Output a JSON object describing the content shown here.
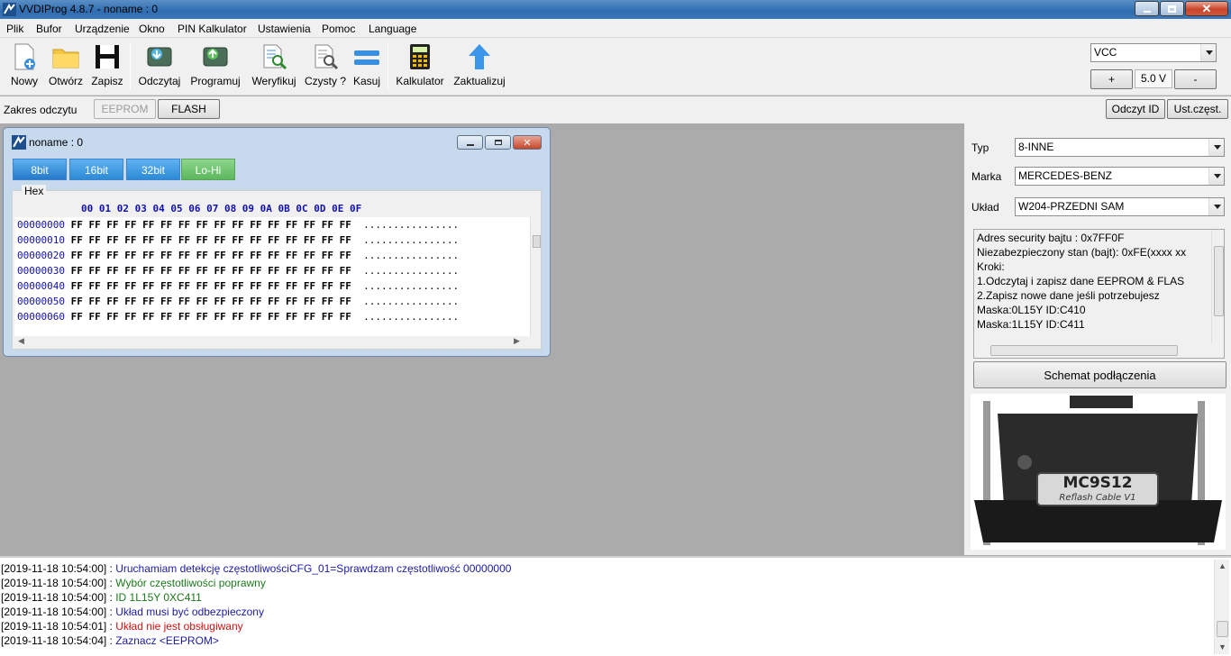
{
  "window": {
    "title": "VVDIProg 4.8.7 - noname : 0"
  },
  "menu": [
    "Plik",
    "Bufor",
    "Urządzenie",
    "Okno",
    "PIN Kalkulator",
    "Ustawienia",
    "Pomoc",
    "Language"
  ],
  "toolbar": {
    "new": "Nowy",
    "open": "Otwórz",
    "save": "Zapisz",
    "read": "Odczytaj",
    "program": "Programuj",
    "verify": "Weryfikuj",
    "blank": "Czysty ?",
    "erase": "Kasuj",
    "calculator": "Kalkulator",
    "update": "Zaktualizuj"
  },
  "power": {
    "select": "VCC",
    "plus": "+",
    "voltage": "5.0 V",
    "minus": "-"
  },
  "range": {
    "label": "Zakres odczytu",
    "eeprom": "EEPROM",
    "flash": "FLASH"
  },
  "right_buttons": {
    "read_id": "Odczyt ID",
    "settings": "Ust.częst."
  },
  "child": {
    "title": "noname : 0",
    "modes": [
      "8bit",
      "16bit",
      "32bit",
      "Lo-Hi"
    ],
    "group": "Hex",
    "header": "00 01 02 03 04 05 06 07 08 09 0A 0B 0C 0D 0E 0F",
    "rows": [
      {
        "addr": "00000000",
        "bytes": "FF FF FF FF FF FF FF FF FF FF FF FF FF FF FF FF",
        "ascii": "................"
      },
      {
        "addr": "00000010",
        "bytes": "FF FF FF FF FF FF FF FF FF FF FF FF FF FF FF FF",
        "ascii": "................"
      },
      {
        "addr": "00000020",
        "bytes": "FF FF FF FF FF FF FF FF FF FF FF FF FF FF FF FF",
        "ascii": "................"
      },
      {
        "addr": "00000030",
        "bytes": "FF FF FF FF FF FF FF FF FF FF FF FF FF FF FF FF",
        "ascii": "................"
      },
      {
        "addr": "00000040",
        "bytes": "FF FF FF FF FF FF FF FF FF FF FF FF FF FF FF FF",
        "ascii": "................"
      },
      {
        "addr": "00000050",
        "bytes": "FF FF FF FF FF FF FF FF FF FF FF FF FF FF FF FF",
        "ascii": "................"
      },
      {
        "addr": "00000060",
        "bytes": "FF FF FF FF FF FF FF FF FF FF FF FF FF FF FF FF",
        "ascii": "................"
      }
    ]
  },
  "device": {
    "type_label": "Typ",
    "type_value": "8-INNE",
    "brand_label": "Marka",
    "brand_value": "MERCEDES-BENZ",
    "chip_label": "Układ",
    "chip_value": "W204-PRZEDNI SAM"
  },
  "info": [
    "Adres security bajtu : 0x7FF0F",
    "Niezabezpieczony stan (bajt): 0xFE(xxxx xx",
    "Kroki:",
    "1.Odczytaj i zapisz dane EEPROM & FLAS",
    "2.Zapisz nowe dane jeśli potrzebujesz",
    "Maska:0L15Y ID:C410",
    "Maska:1L15Y ID:C411"
  ],
  "schema_button": "Schemat podłączenia",
  "cable": {
    "name": "MC9S12",
    "sub": "Reflash Cable V1"
  },
  "log": [
    {
      "ts": "[2019-11-18 10:54:00] : ",
      "msg": "Uruchamiam detekcję częstotliwościCFG_01=Sprawdzam częstotliwość 00000000",
      "color": "#1a1aa6"
    },
    {
      "ts": "[2019-11-18 10:54:00] : ",
      "msg": "Wybór częstotliwości poprawny",
      "color": "#1a7a1a"
    },
    {
      "ts": "[2019-11-18 10:54:00] : ",
      "msg": "ID  1L15Y 0XC411",
      "color": "#1a7a1a"
    },
    {
      "ts": "[2019-11-18 10:54:00] : ",
      "msg": "Układ musi być odbezpieczony",
      "color": "#1a1aa6"
    },
    {
      "ts": "[2019-11-18 10:54:01] : ",
      "msg": "Układ nie jest obsługiwany",
      "color": "#d01010"
    },
    {
      "ts": "[2019-11-18 10:54:04] : ",
      "msg": "Zaznacz <EEPROM>",
      "color": "#1a1aa6"
    }
  ]
}
